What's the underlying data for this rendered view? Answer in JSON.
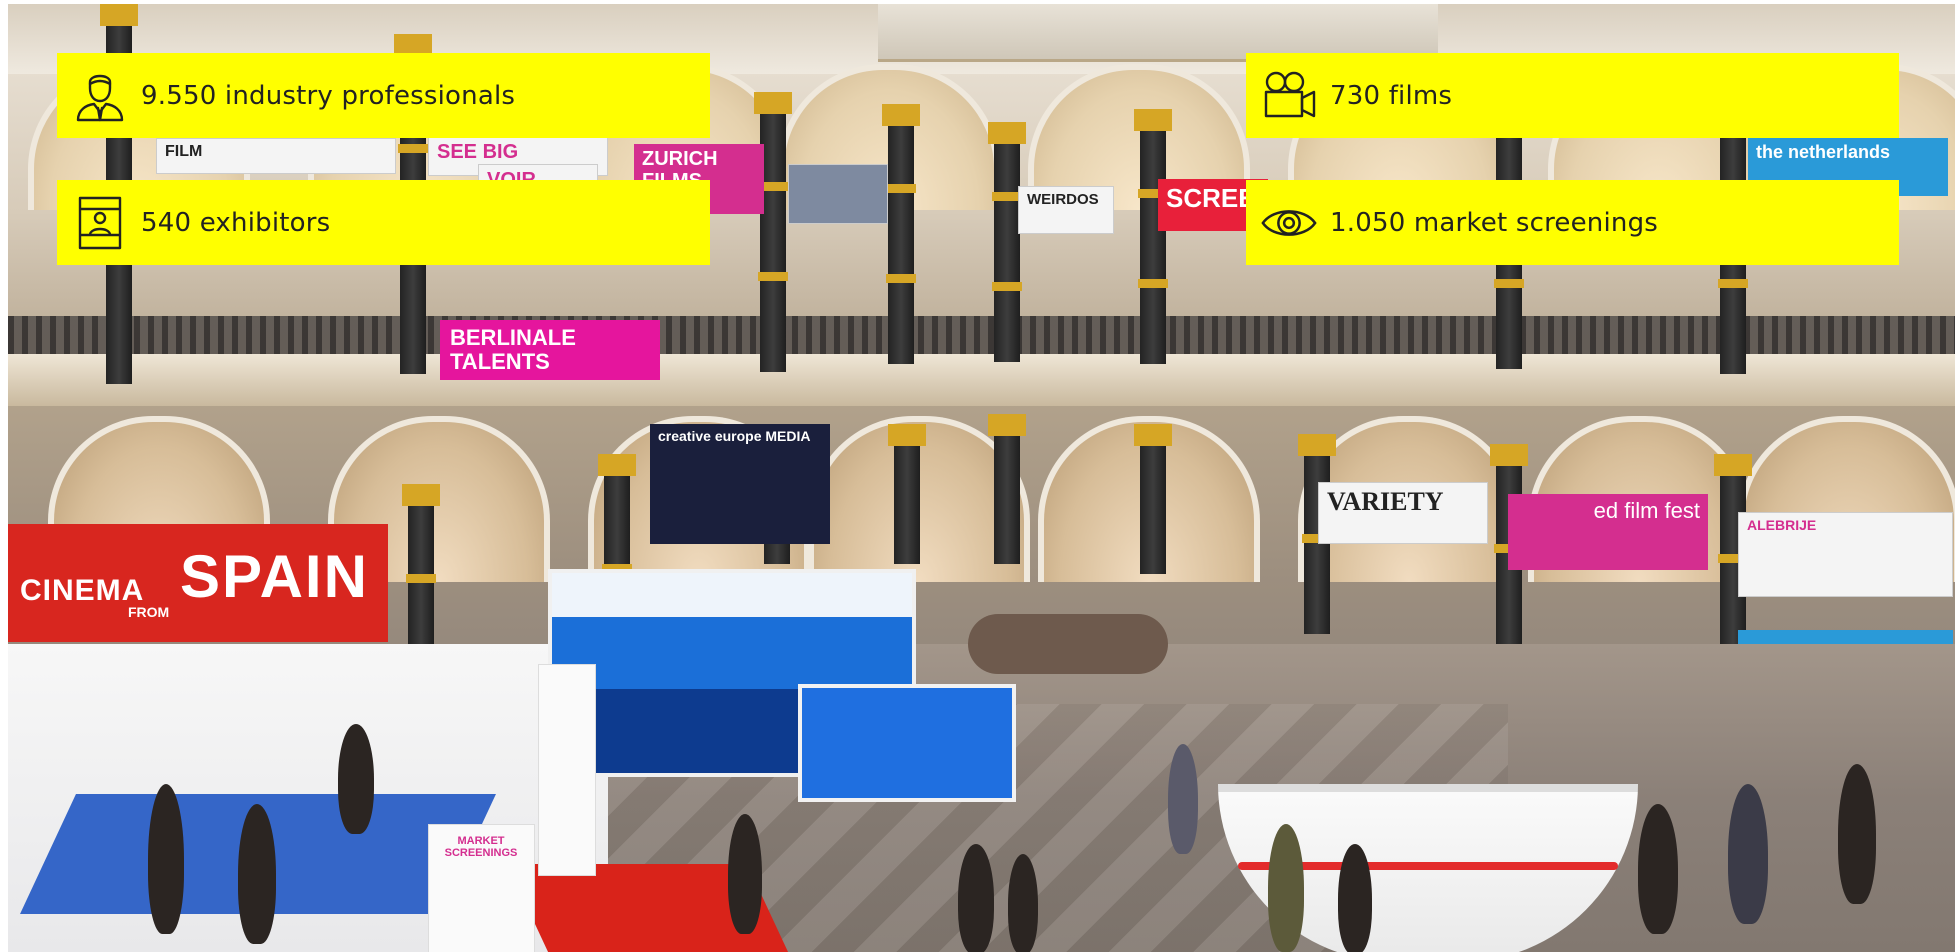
{
  "stats": {
    "professionals": {
      "label": "9.550 industry professionals",
      "icon": "person-icon"
    },
    "exhibitors": {
      "label": "540 exhibitors",
      "icon": "exhibitor-booth-icon"
    },
    "films": {
      "label": "730 films",
      "icon": "film-camera-icon"
    },
    "screenings": {
      "label": "1.050 market screenings",
      "icon": "eye-icon"
    }
  },
  "photo_signage": {
    "cinema_from_spain_1": "CINEMA",
    "cinema_from_spain_2": "SPAIN",
    "cinema_from_spain_3": "FROM",
    "berlinale_talents": "BERLINALE TALENTS",
    "see_big": "SEE BIG",
    "voir": "VOIR",
    "zurich_films": "ZURICH FILMS",
    "weirdos": "WEIRDOS",
    "screen": "SCREEN",
    "variety": "VARIETY",
    "ed_film_fest": "ed film fest",
    "alebrije": "ALEBRIJE",
    "market_screenings": "MARKET SCREENINGS",
    "creative_europe": "creative europe MEDIA",
    "the_netherlands": "the netherlands",
    "film": "FILM"
  },
  "colors": {
    "stat_box_bg": "#ffff00",
    "stat_text": "#222222"
  }
}
